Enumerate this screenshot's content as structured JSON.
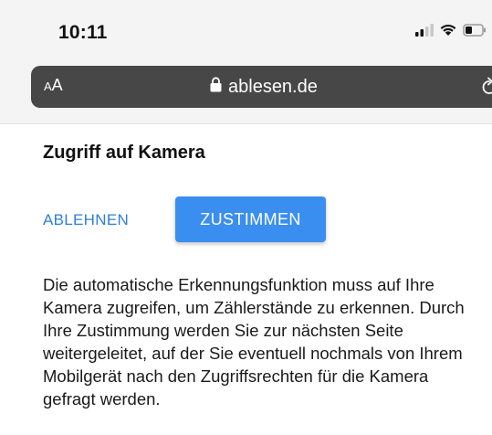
{
  "status_bar": {
    "time": "10:11",
    "icons": [
      "signal-icon",
      "wifi-icon",
      "battery-icon"
    ]
  },
  "address_bar": {
    "aa_small": "A",
    "aa_large": "A",
    "url": "ablesen.de",
    "icons": [
      "lock-icon",
      "reload-icon"
    ]
  },
  "page": {
    "title": "Zugriff auf Kamera",
    "reject_label": "ABLEHNEN",
    "accept_label": "ZUSTIMMEN",
    "description": "Die automatische Erkennungsfunktion muss auf Ihre Kamera zugreifen, um Zählerstände zu erkennen. Durch Ihre Zustimmung werden Sie zur nächsten Seite weitergeleitet, auf der Sie eventuell nochmals von Ihrem Mobilgerät nach den Zugriffsrechten für die Kamera gefragt werden."
  },
  "colors": {
    "accent": "#3a8ef0",
    "link": "#2d7fd8",
    "address_bar_bg": "#474747"
  }
}
